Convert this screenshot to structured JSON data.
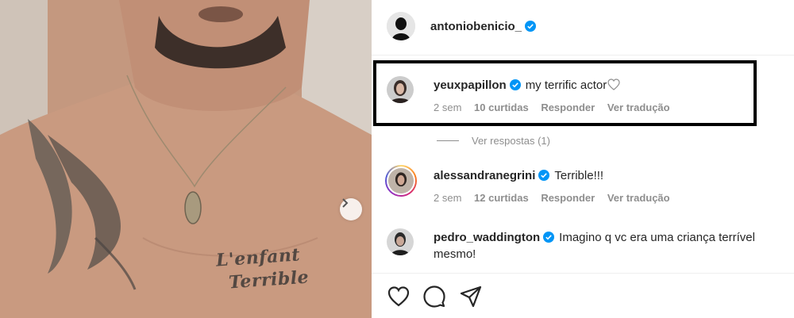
{
  "post": {
    "author": "antoniobenicio_",
    "tattoo_text": [
      "L'enfant",
      "Terrible"
    ]
  },
  "comments": [
    {
      "username": "yeuxpapillon",
      "text": "my terrific actor",
      "time": "2 sem",
      "likes": "10 curtidas",
      "reply": "Responder",
      "translate": "Ver tradução"
    },
    {
      "username": "alessandranegrini",
      "text": "Terrible!!!",
      "time": "2 sem",
      "likes": "12 curtidas",
      "reply": "Responder",
      "translate": "Ver tradução"
    },
    {
      "username": "pedro_waddington",
      "text": "Imagino q vc era uma criança terrível",
      "text_line2": "mesmo!"
    }
  ],
  "view_replies": "Ver respostas (1)",
  "colors": {
    "verified": "#0095f6",
    "meta": "#8e8e8e",
    "highlight_border": "#000000"
  },
  "icons": [
    "heart-icon",
    "comment-icon",
    "share-icon",
    "verified-badge-icon",
    "chevron-right-icon"
  ]
}
